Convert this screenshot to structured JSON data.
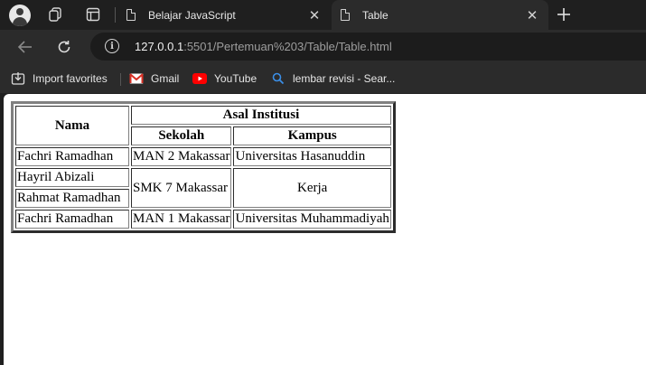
{
  "browser": {
    "tabs": [
      {
        "title": "Belajar JavaScript",
        "active": false
      },
      {
        "title": "Table",
        "active": true
      }
    ],
    "url": {
      "host": "127.0.0.1",
      "rest": ":5501/Pertemuan%203/Table/Table.html"
    },
    "bookmarks": [
      {
        "label": "Import favorites",
        "icon": "import-icon"
      },
      {
        "label": "Gmail",
        "icon": "gmail-icon"
      },
      {
        "label": "YouTube",
        "icon": "youtube-icon"
      },
      {
        "label": "lembar revisi - Sear...",
        "icon": "search-icon"
      }
    ]
  },
  "table": {
    "headers": {
      "nama": "Nama",
      "asal": "Asal Institusi",
      "sekolah": "Sekolah",
      "kampus": "Kampus"
    },
    "rows": [
      {
        "nama": "Fachri Ramadhan",
        "sekolah": "MAN 2 Makassar",
        "kampus": "Universitas Hasanuddin"
      },
      {
        "nama": "Hayril Abizali",
        "sekolah": "SMK 7 Makassar",
        "kampus": "Kerja"
      },
      {
        "nama": "Rahmat Ramadhan"
      },
      {
        "nama": "Fachri Ramadhan",
        "sekolah": "MAN 1 Makassar",
        "kampus": "Universitas Muhammadiyah"
      }
    ]
  }
}
